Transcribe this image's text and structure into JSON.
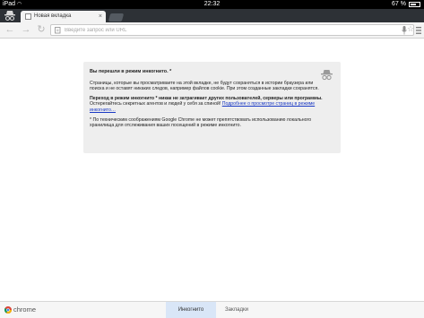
{
  "status_bar": {
    "carrier": "iPad",
    "time": "22:32",
    "battery_percent_text": "67 %",
    "battery_level": 0.67
  },
  "tab_strip": {
    "tabs": [
      {
        "title": "Новая вкладка",
        "close_symbol": "×",
        "favicon": "page-icon"
      }
    ]
  },
  "toolbar": {
    "back_symbol": "←",
    "forward_symbol": "→",
    "reload_symbol": "↻",
    "omnibox_placeholder": "Введите запрос или URL",
    "star_symbol": "☆"
  },
  "incognito_card": {
    "heading": "Вы перешли в режим инкогнито. *",
    "paragraph_1": "Страницы, которые вы просматриваете на этой вкладке, не будут сохраняться в истории браузера или поиска и не оставят никаких следов, например файлов cookie. При этом созданные закладки сохранятся.",
    "paragraph_2_bold": "Переход в режим инкогнито * никак не затрагивает других пользователей, серверы или программы.",
    "paragraph_2_text": " Остерегайтесь секретных агентов и людей у себя за спиной! ",
    "paragraph_2_link": "Подробнее о просмотре страниц в режиме инкогнито…",
    "paragraph_3": "* По техническим соображениям Google Chrome не может препятствовать использованию локального хранилища для отслеживания ваших посещений в режиме инкогнито."
  },
  "bottom_bar": {
    "brand": "chrome",
    "tabs": [
      {
        "label": "Инкогнито",
        "active": true
      },
      {
        "label": "Закладки",
        "active": false
      }
    ]
  },
  "colors": {
    "tab_strip_background": "#2d3136",
    "card_background": "#eeeeee",
    "link": "#1a39c4",
    "active_bottom_tab": "#d9e6f7"
  }
}
